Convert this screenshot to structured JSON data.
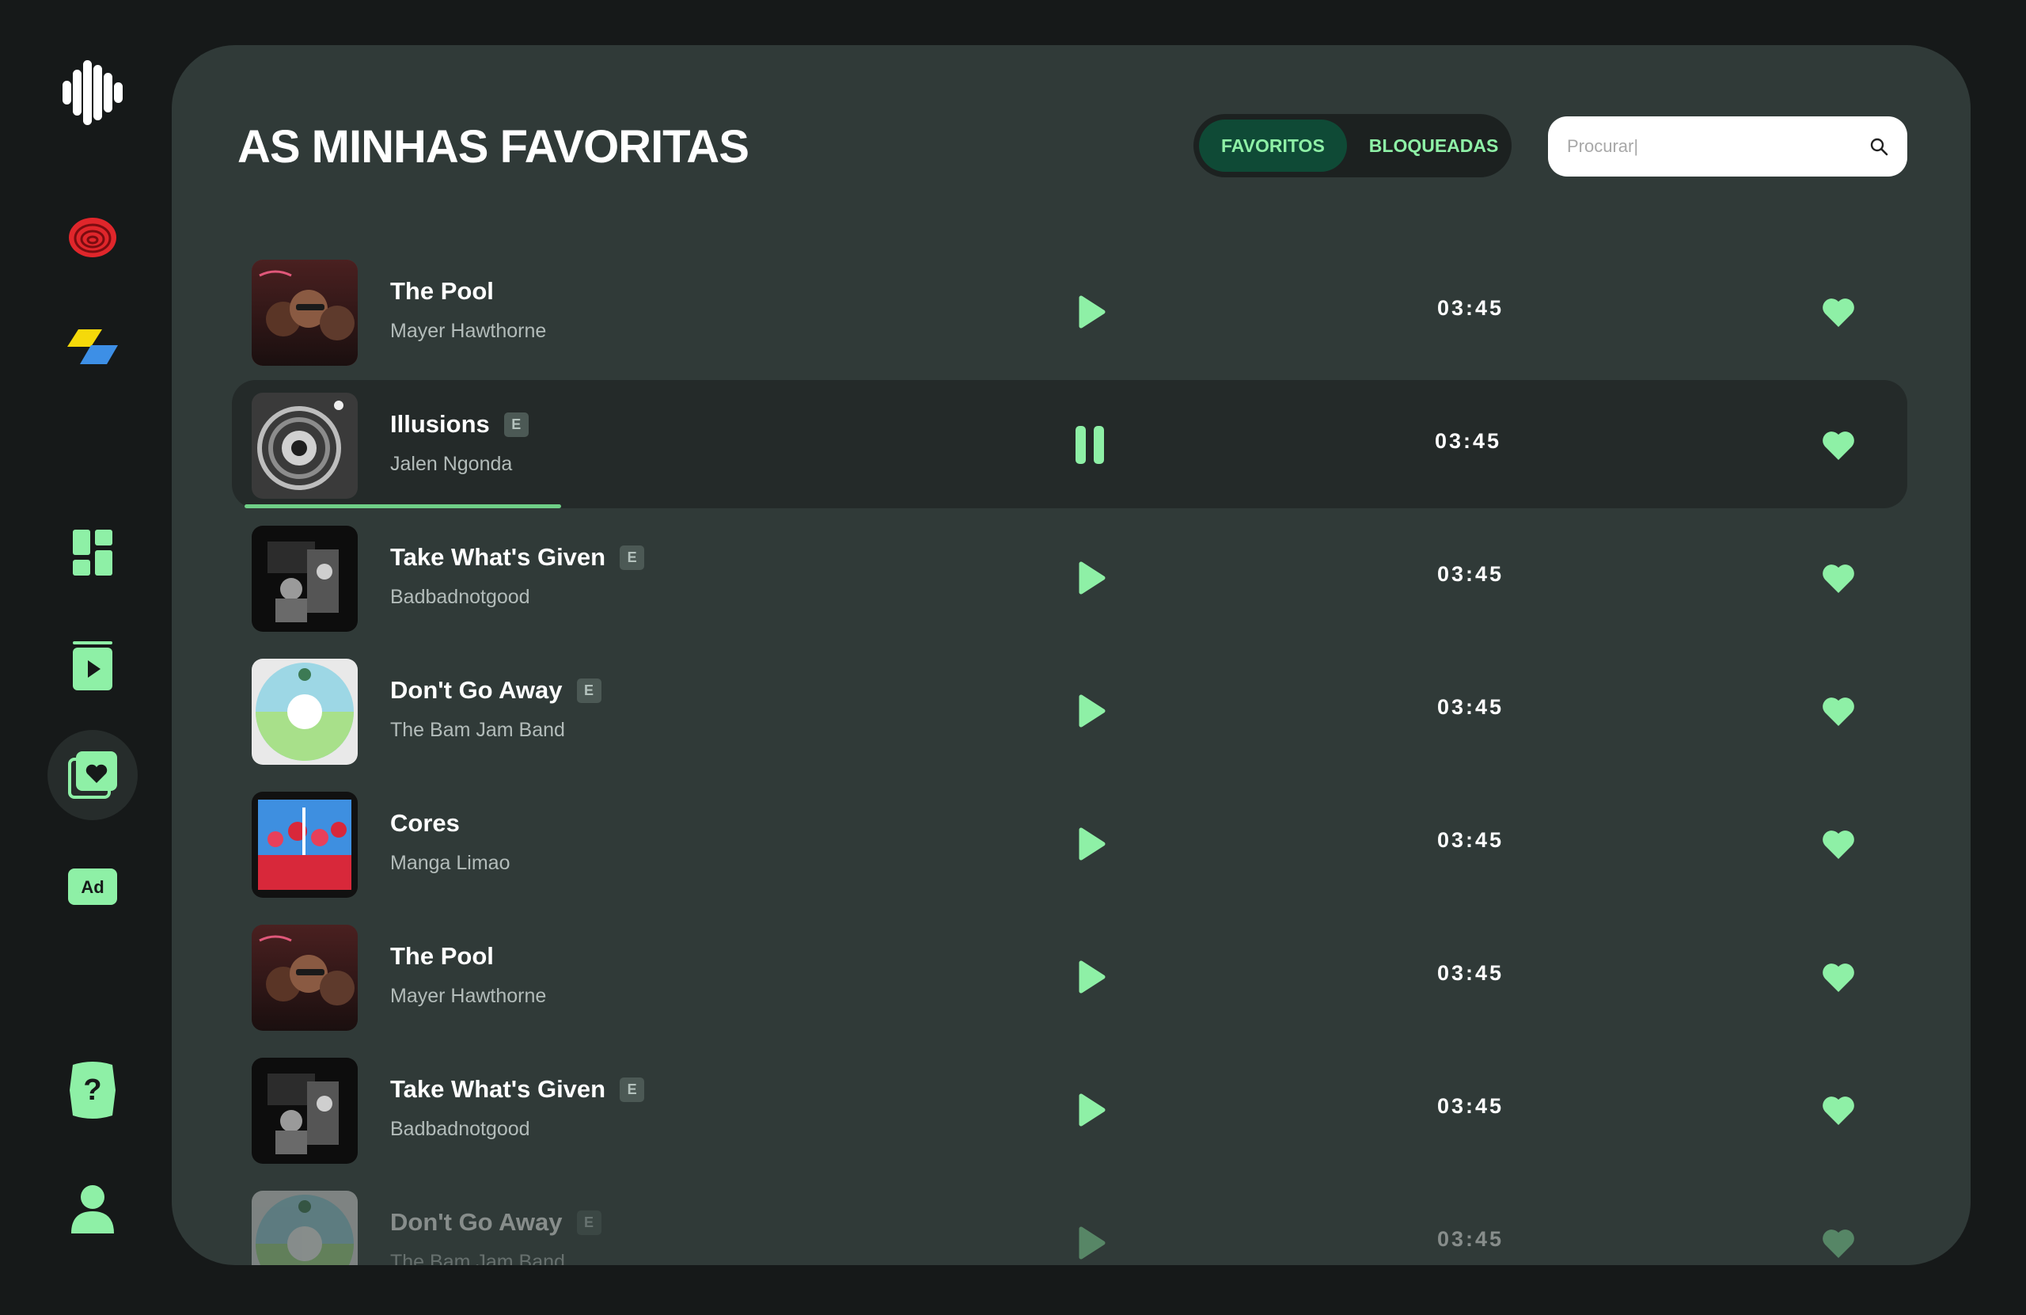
{
  "app": {
    "accent_color": "#8ef0a6",
    "panel_color": "#303a38",
    "background_color": "#161919"
  },
  "sidebar": {
    "items": [
      {
        "name": "logo",
        "icon": "soundwave-logo-icon"
      },
      {
        "name": "red-app",
        "icon": "red-spiral-icon"
      },
      {
        "name": "colorful-app",
        "icon": "yellow-blue-parallelogram-icon"
      },
      {
        "name": "dashboard",
        "icon": "grid-icon"
      },
      {
        "name": "player",
        "icon": "play-screen-icon"
      },
      {
        "name": "favorites",
        "icon": "heart-library-icon",
        "active": true
      },
      {
        "name": "ads",
        "icon": "ad-icon",
        "label": "Ad"
      },
      {
        "name": "help",
        "icon": "question-icon",
        "label": "?"
      },
      {
        "name": "profile",
        "icon": "user-icon"
      }
    ]
  },
  "header": {
    "title": "AS MINHAS FAVORITAS",
    "tabs": [
      {
        "label": "FAVORITOS",
        "active": true
      },
      {
        "label": "BLOQUEADAS",
        "active": false
      }
    ],
    "search": {
      "placeholder": "Procurar|",
      "value": ""
    }
  },
  "tracks": [
    {
      "title": "The Pool",
      "artist": "Mayer Hawthorne",
      "explicit": false,
      "duration": "03:45",
      "state": "play",
      "liked": true,
      "cover_color": "#7a3a3a"
    },
    {
      "title": "Illusions",
      "artist": "Jalen Ngonda",
      "explicit": true,
      "explicit_label": "E",
      "duration": "03:45",
      "state": "pause",
      "liked": true,
      "progress": 0.5,
      "cover_color": "#8c8c8c"
    },
    {
      "title": "Take What's Given",
      "artist": "Badbadnotgood",
      "explicit": true,
      "explicit_label": "E",
      "duration": "03:45",
      "state": "play",
      "liked": true,
      "cover_color": "#2a2a2a"
    },
    {
      "title": "Don't Go Away",
      "artist": "The Bam Jam Band",
      "explicit": true,
      "explicit_label": "E",
      "duration": "03:45",
      "state": "play",
      "liked": true,
      "cover_color": "#9dd7e5"
    },
    {
      "title": "Cores",
      "artist": "Manga Limao",
      "explicit": false,
      "duration": "03:45",
      "state": "play",
      "liked": true,
      "cover_color": "#d8283a"
    },
    {
      "title": "The Pool",
      "artist": "Mayer Hawthorne",
      "explicit": false,
      "duration": "03:45",
      "state": "play",
      "liked": true,
      "cover_color": "#7a3a3a"
    },
    {
      "title": "Take What's Given",
      "artist": "Badbadnotgood",
      "explicit": true,
      "explicit_label": "E",
      "duration": "03:45",
      "state": "play",
      "liked": true,
      "cover_color": "#2a2a2a"
    },
    {
      "title": "Don't Go Away",
      "artist": "The Bam Jam Band",
      "explicit": true,
      "explicit_label": "E",
      "duration": "03:45",
      "state": "play",
      "liked": true,
      "cover_color": "#9dd7e5"
    }
  ]
}
